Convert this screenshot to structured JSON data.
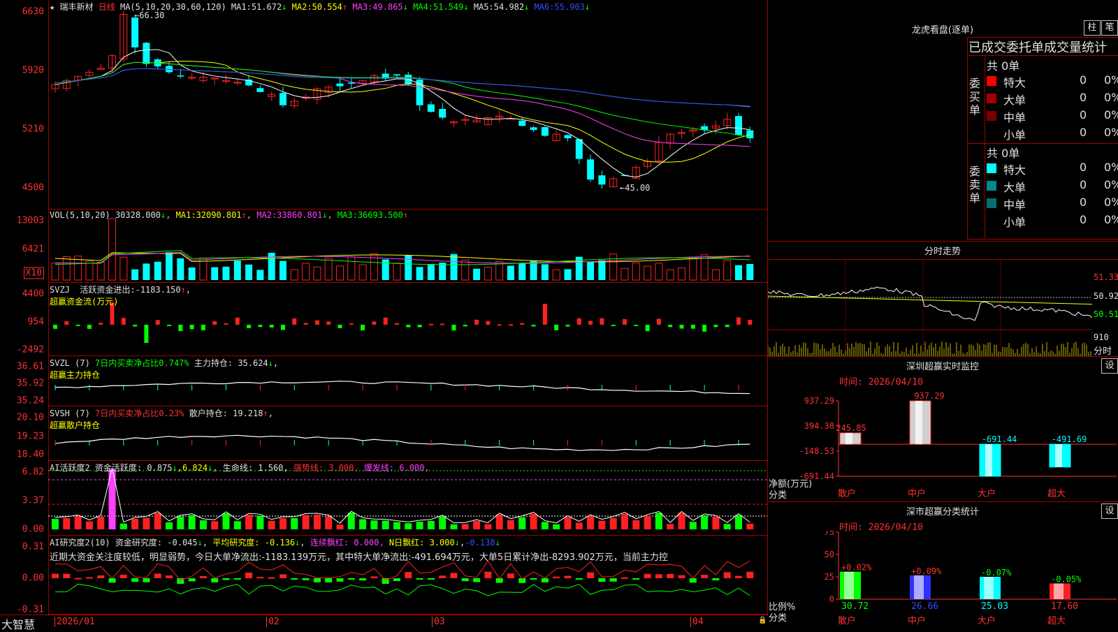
{
  "stock": {
    "star": "★",
    "name": "瑞丰新材",
    "period": "日线",
    "ma_params": "MA(5,10,20,30,60,120)",
    "ma_values": [
      {
        "label": "MA1:",
        "value": "51.672",
        "arrow": "↓"
      },
      {
        "label": "MA2:",
        "value": "50.554",
        "arrow": "↑"
      },
      {
        "label": "MA3:",
        "value": "49.865",
        "arrow": "↓"
      },
      {
        "label": "MA4:",
        "value": "51.549",
        "arrow": "↓"
      },
      {
        "label": "MA5:",
        "value": "54.982",
        "arrow": "↓"
      },
      {
        "label": "MA6:",
        "value": "55.903",
        "arrow": "↓"
      }
    ],
    "high_label": "66.30",
    "low_label": "45.00",
    "price_axis": [
      "6630",
      "5920",
      "5210",
      "4500"
    ]
  },
  "vol": {
    "header": "VOL(5,10,20)",
    "value": "30328.000",
    "arrow": "↓",
    "ma": [
      {
        "label": "MA1:",
        "value": "32090.801",
        "arrow": "↑"
      },
      {
        "label": "MA2:",
        "value": "33860.801",
        "arrow": "↓"
      },
      {
        "label": "MA3:",
        "value": "36693.500",
        "arrow": "↑"
      }
    ],
    "axis": [
      "13003",
      "6421"
    ],
    "unit": "X10"
  },
  "svzj": {
    "header": "SVZJ",
    "label": "活跃资金进出:",
    "value": "-1183.150",
    "arrow": "↑",
    "sub": "超赢资金流(万元)",
    "axis": [
      "4400",
      "954",
      "-2492"
    ]
  },
  "svzl": {
    "header": "SVZL (7)",
    "ratio": "7日内买卖净占比0.747%",
    "label": "主力持仓:",
    "value": "35.624",
    "arrow": "↓",
    "sub": "超赢主力持仓",
    "axis": [
      "36.61",
      "35.92",
      "35.24"
    ]
  },
  "svsh": {
    "header": "SVSH (7)",
    "ratio": "7日内买卖净占比0.23%",
    "label": "散户持仓:",
    "value": "19.218",
    "arrow": "↑",
    "sub": "超赢散户持仓",
    "axis": [
      "20.10",
      "19.23",
      "18.40"
    ]
  },
  "ai1": {
    "header": "AI活跃度2",
    "label": "资金活跃度:",
    "value": "0.875",
    "v2": "6.824",
    "label3": "生命线:",
    "v3": "1.560,",
    "strong": "强势线: 3.000,",
    "burst": "爆发线: 6.000,",
    "axis": [
      "6.82",
      "3.37",
      "0.00"
    ]
  },
  "ai2": {
    "header": "AI研究度2(10)",
    "label": "资金研究度:",
    "value": "-0.045",
    "avg": "平均研究度:",
    "avg_value": "-0.136",
    "red": "连续飘红: 0.000,",
    "nred": "N日飘红: 3.000",
    "last": "-0.138",
    "text": "近期大资金关注度较低，明显弱势，今日大单净流出:-1183.139万元，其中特大单净流出:-491.694万元，大单5日累计净出-8293.902万元，当前主力控",
    "axis": [
      "0.31",
      "0.00",
      "-0.31"
    ]
  },
  "xaxis": {
    "brand": "大智慧",
    "dates": [
      "2026/01",
      "02",
      "03",
      "04"
    ]
  },
  "right": {
    "lhb_title": "龙虎看盘(逐单)",
    "btn_bar": "柱",
    "btn_pen": "笔",
    "order_title": "已成交委托单成交量统计",
    "buy_label": "委买单",
    "sell_label": "委卖单",
    "buy_total": "共 0单",
    "sell_total": "共 0单",
    "buy_rows": [
      {
        "name": "特大",
        "vol": "0",
        "pct": "0%"
      },
      {
        "name": "大单",
        "vol": "0",
        "pct": "0%"
      },
      {
        "name": "中单",
        "vol": "0",
        "pct": "0%"
      },
      {
        "name": "小单",
        "vol": "0",
        "pct": "0%"
      }
    ],
    "sell_rows": [
      {
        "name": "特大",
        "vol": "0",
        "pct": "0%"
      },
      {
        "name": "大单",
        "vol": "0",
        "pct": "0%"
      },
      {
        "name": "中单",
        "vol": "0",
        "pct": "0%"
      },
      {
        "name": "小单",
        "vol": "0",
        "pct": "0%"
      }
    ],
    "fs_title": "分时走势",
    "fs_axis": [
      "51.33",
      "50.92",
      "50.51",
      "910"
    ],
    "fs_unit": "分时",
    "sz_title": "深圳超赢实时监控",
    "sz_set": "设",
    "sz_time": "时间: 2026/04/10",
    "sz_axis": [
      "937.29",
      "394.38",
      "-148.53",
      "-691.44"
    ],
    "sz_ylabel": "净额(万元)",
    "sz_xlabel": "分类",
    "sz_bars": [
      {
        "cat": "散户",
        "value": 245.85,
        "label": "245.85"
      },
      {
        "cat": "中户",
        "value": 937.29,
        "label": "937.29"
      },
      {
        "cat": "大户",
        "value": -691.44,
        "label": "-691.44"
      },
      {
        "cat": "超大",
        "value": -491.69,
        "label": "-491.69"
      }
    ],
    "cls_title": "深市超赢分类统计",
    "cls_set": "设",
    "cls_time": "时间: 2026/04/10",
    "cls_axis": [
      "75",
      "50",
      "25",
      "0"
    ],
    "cls_ylabel": "比例%",
    "cls_xlabel": "分类",
    "cls_bars": [
      {
        "cat": "散户",
        "value": 30.72,
        "label": "30.72",
        "delta": "+0.02%"
      },
      {
        "cat": "中户",
        "value": 26.66,
        "label": "26.66",
        "delta": "+0.09%"
      },
      {
        "cat": "大户",
        "value": 25.03,
        "label": "25.03",
        "delta": "-0.07%"
      },
      {
        "cat": "超大",
        "value": 17.6,
        "label": "17.60",
        "delta": "-0.05%"
      }
    ]
  },
  "colors": {
    "up": "#ff2020",
    "down": "#00ffff",
    "grid": "#a00000",
    "ma1": "#ffffff",
    "ma2": "#ffff00",
    "ma3": "#ff40ff",
    "ma4": "#00ff00",
    "ma5": "#808080",
    "ma6": "#3050ff"
  }
}
